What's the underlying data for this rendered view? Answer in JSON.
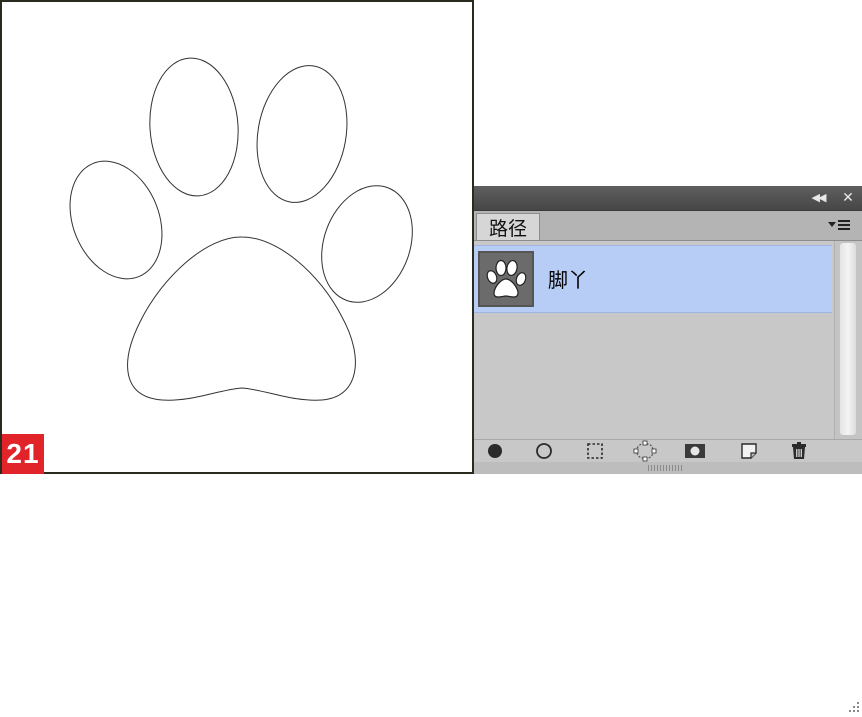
{
  "step_badge": "21",
  "panel": {
    "tab_label": "路径",
    "collapse_icon": "double-chevron-left-icon",
    "close_icon": "close-icon",
    "menu_icon": "panel-menu-icon",
    "paths": [
      {
        "name": "脚丫",
        "thumbnail": "paw-thumbnail",
        "selected": true
      }
    ],
    "bottom_tools": [
      "fill-path-icon",
      "stroke-path-icon",
      "load-as-selection-icon",
      "make-work-path-icon",
      "add-mask-icon",
      "new-path-icon",
      "delete-path-icon"
    ]
  },
  "colors": {
    "selection": "#b7cdf6",
    "badge": "#e0242a",
    "panel_bg": "#c8c8c8",
    "titlebar": "#474747"
  }
}
